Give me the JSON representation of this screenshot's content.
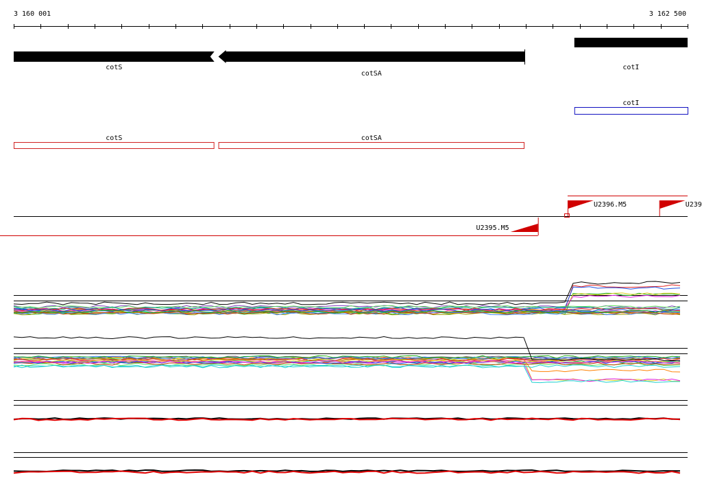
{
  "ruler": {
    "start_label": "3 160 001",
    "end_label": "3 162 500",
    "start": 3160001,
    "end": 3162500
  },
  "genes": [
    {
      "name": "cotS",
      "start": 3160001,
      "end": 3160745,
      "strand": "-"
    },
    {
      "name": "cotSA",
      "start": 3160760,
      "end": 3161895,
      "strand": "-"
    },
    {
      "name": "cotI",
      "start": 3162080,
      "end": 3162500,
      "strand": "+"
    }
  ],
  "annotations": {
    "blue": [
      {
        "name": "cotI",
        "start": 3162080,
        "end": 3162500
      }
    ],
    "red": [
      {
        "name": "cotS",
        "start": 3160001,
        "end": 3160745
      },
      {
        "name": "cotSA",
        "start": 3160760,
        "end": 3161895
      }
    ]
  },
  "transcription_units": {
    "upper": [
      {
        "label": "U2396.M5",
        "start": 3162055,
        "end": 3162500
      },
      {
        "label": "U239",
        "start": 3162395,
        "end": 3162500
      }
    ],
    "lower": [
      {
        "label": "U2395.M5",
        "start": 3160001,
        "end": 3161945
      }
    ]
  },
  "colors": {
    "gene": "#000000",
    "blue_box": "#1010c0",
    "red_box": "#d02020",
    "tu_line": "#d00000",
    "track_palette": [
      "#e02020",
      "#2050e0",
      "#20b020",
      "#e0d020",
      "#e020e0",
      "#20d0d0",
      "#ff8000",
      "#8040c0",
      "#60e060",
      "#a0a000",
      "#ff60a0",
      "#00a080",
      "#606060",
      "#4080ff",
      "#c04000"
    ]
  }
}
